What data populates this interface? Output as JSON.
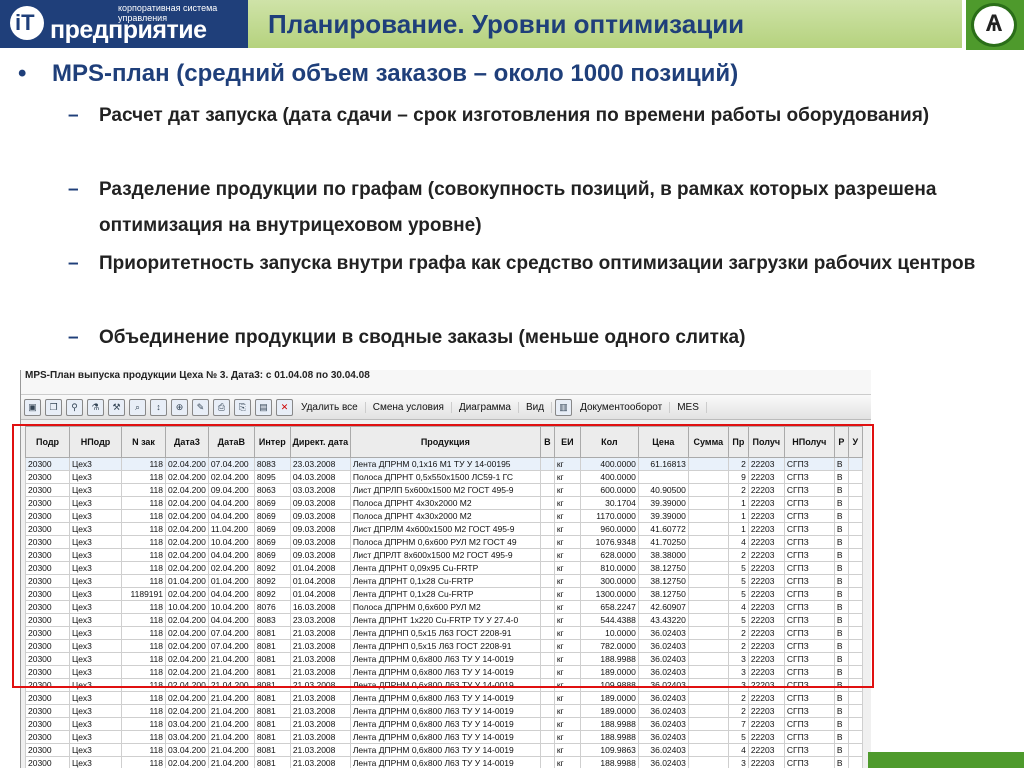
{
  "header": {
    "logo_name": "предприятие",
    "logo_sub": "корпоративная система управления",
    "title": "Планирование. Уровни оптимизации"
  },
  "bullets": {
    "main": "MPS-план (средний объем заказов – около 1000 позиций)",
    "subs": [
      "Расчет дат запуска (дата сдачи – срок изготовления по времени работы оборудования)",
      "Разделение продукции по графам (совокупность позиций, в рамках которых разрешена оптимизация на внутрицеховом уровне)",
      "Приоритетность запуска внутри графа как средство оптимизации загрузки рабочих центров",
      "Объединение продукции в сводные заказы (меньше одного слитка)"
    ]
  },
  "window": {
    "title": "MPS-План выпуска продукции Цеха № 3. Дата3: с 01.04.08 по 30.04.08",
    "toolbar_buttons": [
      "Удалить все",
      "Смена условия",
      "Диаграмма",
      "Вид",
      "Документооборот",
      "MES"
    ],
    "columns": [
      "Подр",
      "НПодр",
      "N зак",
      "Дата3",
      "ДатаВ",
      "Интер",
      "Директ. дата",
      "Продукция",
      "В",
      "ЕИ",
      "Кол",
      "Цена",
      "Сумма",
      "Пр",
      "Получ",
      "НПолуч",
      "Р",
      "У"
    ],
    "rows": [
      [
        "20300",
        "Цех3",
        "118",
        "02.04.200",
        "07.04.200",
        "8083",
        "23.03.2008",
        "Лента ДПРНМ 0,1х16 М1 ТУ У 14-00195",
        "",
        "кг",
        "400.0000",
        "61.16813",
        "",
        "2",
        "22203",
        "СГПЗ",
        "В",
        ""
      ],
      [
        "20300",
        "Цех3",
        "118",
        "02.04.200",
        "02.04.200",
        "8095",
        "04.03.2008",
        "Полоса ДПРНТ 0,5х550х1500 ЛС59-1 ГС",
        "",
        "кг",
        "400.0000",
        "",
        "",
        "9",
        "22203",
        "СГПЗ",
        "В",
        ""
      ],
      [
        "20300",
        "Цех3",
        "118",
        "02.04.200",
        "09.04.200",
        "8063",
        "03.03.2008",
        "Лист ДПРЛП 5х600х1500 М2 ГОСТ 495-9",
        "",
        "кг",
        "600.0000",
        "40.90500",
        "",
        "2",
        "22203",
        "СГПЗ",
        "В",
        ""
      ],
      [
        "20300",
        "Цех3",
        "118",
        "02.04.200",
        "04.04.200",
        "8069",
        "09.03.2008",
        "Полоса ДПРНТ 4х30х2000 М2",
        "",
        "кг",
        "30.1704",
        "39.39000",
        "",
        "1",
        "22203",
        "СГПЗ",
        "В",
        ""
      ],
      [
        "20300",
        "Цех3",
        "118",
        "02.04.200",
        "04.04.200",
        "8069",
        "09.03.2008",
        "Полоса ДПРНТ 4х30х2000 М2",
        "",
        "кг",
        "1170.0000",
        "39.39000",
        "",
        "1",
        "22203",
        "СГПЗ",
        "В",
        ""
      ],
      [
        "20300",
        "Цех3",
        "118",
        "02.04.200",
        "11.04.200",
        "8069",
        "09.03.2008",
        "Лист ДПРЛМ 4х600х1500 М2 ГОСТ 495-9",
        "",
        "кг",
        "960.0000",
        "41.60772",
        "",
        "1",
        "22203",
        "СГПЗ",
        "В",
        ""
      ],
      [
        "20300",
        "Цех3",
        "118",
        "02.04.200",
        "10.04.200",
        "8069",
        "09.03.2008",
        "Полоса ДПРНМ 0,6х600 РУЛ М2 ГОСТ 49",
        "",
        "кг",
        "1076.9348",
        "41.70250",
        "",
        "4",
        "22203",
        "СГПЗ",
        "В",
        ""
      ],
      [
        "20300",
        "Цех3",
        "118",
        "02.04.200",
        "04.04.200",
        "8069",
        "09.03.2008",
        "Лист ДПРЛТ 8х600х1500 М2 ГОСТ 495-9",
        "",
        "кг",
        "628.0000",
        "38.38000",
        "",
        "2",
        "22203",
        "СГПЗ",
        "В",
        ""
      ],
      [
        "20300",
        "Цех3",
        "118",
        "02.04.200",
        "02.04.200",
        "8092",
        "01.04.2008",
        "Лента ДПРНТ 0,09х95 Cu-FRTP",
        "",
        "кг",
        "810.0000",
        "38.12750",
        "",
        "5",
        "22203",
        "СГПЗ",
        "В",
        ""
      ],
      [
        "20300",
        "Цех3",
        "118",
        "01.04.200",
        "01.04.200",
        "8092",
        "01.04.2008",
        "Лента ДПРНТ 0,1х28 Cu-FRTP",
        "",
        "кг",
        "300.0000",
        "38.12750",
        "",
        "5",
        "22203",
        "СГПЗ",
        "В",
        ""
      ],
      [
        "20300",
        "Цех3",
        "1189191",
        "02.04.200",
        "04.04.200",
        "8092",
        "01.04.2008",
        "Лента ДПРНТ 0,1х28 Cu-FRTP",
        "",
        "кг",
        "1300.0000",
        "38.12750",
        "",
        "5",
        "22203",
        "СГПЗ",
        "В",
        ""
      ],
      [
        "20300",
        "Цех3",
        "118",
        "10.04.200",
        "10.04.200",
        "8076",
        "16.03.2008",
        "Полоса ДПРНМ 0,6х600 РУЛ М2",
        "",
        "кг",
        "658.2247",
        "42.60907",
        "",
        "4",
        "22203",
        "СГПЗ",
        "В",
        ""
      ],
      [
        "20300",
        "Цех3",
        "118",
        "02.04.200",
        "04.04.200",
        "8083",
        "23.03.2008",
        "Лента ДПРНТ 1х220 Cu-FRTP ТУ У 27.4-0",
        "",
        "кг",
        "544.4388",
        "43.43220",
        "",
        "5",
        "22203",
        "СГПЗ",
        "В",
        ""
      ],
      [
        "20300",
        "Цех3",
        "118",
        "02.04.200",
        "07.04.200",
        "8081",
        "21.03.2008",
        "Лента ДПРНП 0,5х15 Л63 ГОСТ 2208-91",
        "",
        "кг",
        "10.0000",
        "36.02403",
        "",
        "2",
        "22203",
        "СГПЗ",
        "В",
        ""
      ],
      [
        "20300",
        "Цех3",
        "118",
        "02.04.200",
        "07.04.200",
        "8081",
        "21.03.2008",
        "Лента ДПРНП 0,5х15 Л63 ГОСТ 2208-91",
        "",
        "кг",
        "782.0000",
        "36.02403",
        "",
        "2",
        "22203",
        "СГПЗ",
        "В",
        ""
      ],
      [
        "20300",
        "Цех3",
        "118",
        "02.04.200",
        "21.04.200",
        "8081",
        "21.03.2008",
        "Лента ДПРНМ 0,6х800 Л63 ТУ У 14-0019",
        "",
        "кг",
        "188.9988",
        "36.02403",
        "",
        "3",
        "22203",
        "СГПЗ",
        "В",
        ""
      ],
      [
        "20300",
        "Цех3",
        "118",
        "02.04.200",
        "21.04.200",
        "8081",
        "21.03.2008",
        "Лента ДПРНМ 0,6х800 Л63 ТУ У 14-0019",
        "",
        "кг",
        "189.0000",
        "36.02403",
        "",
        "3",
        "22203",
        "СГПЗ",
        "В",
        ""
      ],
      [
        "20300",
        "Цех3",
        "118",
        "02.04.200",
        "21.04.200",
        "8081",
        "21.03.2008",
        "Лента ДПРНМ 0,6х800 Л63 ТУ У 14-0019",
        "",
        "кг",
        "109.9888",
        "36.02403",
        "",
        "3",
        "22203",
        "СГПЗ",
        "В",
        ""
      ],
      [
        "20300",
        "Цех3",
        "118",
        "02.04.200",
        "21.04.200",
        "8081",
        "21.03.2008",
        "Лента ДПРНМ 0,6х800 Л63 ТУ У 14-0019",
        "",
        "кг",
        "189.0000",
        "36.02403",
        "",
        "2",
        "22203",
        "СГПЗ",
        "В",
        ""
      ],
      [
        "20300",
        "Цех3",
        "118",
        "02.04.200",
        "21.04.200",
        "8081",
        "21.03.2008",
        "Лента ДПРНМ 0,6х800 Л63 ТУ У 14-0019",
        "",
        "кг",
        "189.0000",
        "36.02403",
        "",
        "2",
        "22203",
        "СГПЗ",
        "В",
        ""
      ],
      [
        "20300",
        "Цех3",
        "118",
        "03.04.200",
        "21.04.200",
        "8081",
        "21.03.2008",
        "Лента ДПРНМ 0,6х800 Л63 ТУ У 14-0019",
        "",
        "кг",
        "188.9988",
        "36.02403",
        "",
        "7",
        "22203",
        "СГПЗ",
        "В",
        ""
      ],
      [
        "20300",
        "Цех3",
        "118",
        "03.04.200",
        "21.04.200",
        "8081",
        "21.03.2008",
        "Лента ДПРНМ 0,6х800 Л63 ТУ У 14-0019",
        "",
        "кг",
        "188.9988",
        "36.02403",
        "",
        "5",
        "22203",
        "СГПЗ",
        "В",
        ""
      ],
      [
        "20300",
        "Цех3",
        "118",
        "03.04.200",
        "21.04.200",
        "8081",
        "21.03.2008",
        "Лента ДПРНМ 0,6х800 Л63 ТУ У 14-0019",
        "",
        "кг",
        "109.9863",
        "36.02403",
        "",
        "4",
        "22203",
        "СГПЗ",
        "В",
        ""
      ],
      [
        "20300",
        "Цех3",
        "118",
        "02.04.200",
        "21.04.200",
        "8081",
        "21.03.2008",
        "Лента ДПРНМ 0,6х800 Л63 ТУ У 14-0019",
        "",
        "кг",
        "188.9988",
        "36.02403",
        "",
        "3",
        "22203",
        "СГПЗ",
        "В",
        ""
      ]
    ]
  },
  "colors": {
    "brand_blue": "#1f3f7a",
    "title_green": "#b5d27e",
    "accent_green": "#4e9a2c",
    "highlight_red": "#e01010"
  }
}
